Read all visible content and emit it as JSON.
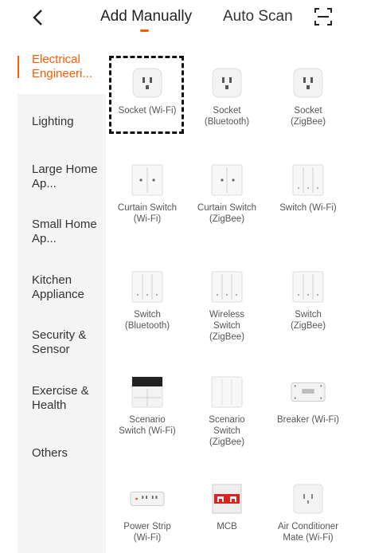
{
  "header": {
    "tab_manual": "Add Manually",
    "tab_auto": "Auto Scan",
    "active_tab": "Add Manually",
    "accent_color": "#ff5a00"
  },
  "sidebar": {
    "items": [
      {
        "label": "Electrical Engineeri...",
        "active": true
      },
      {
        "label": "Lighting"
      },
      {
        "label": "Large Home Ap..."
      },
      {
        "label": "Small Home Ap..."
      },
      {
        "label": "Kitchen Appliance"
      },
      {
        "label": "Security & Sensor"
      },
      {
        "label": "Exercise & Health"
      },
      {
        "label": "Others"
      }
    ]
  },
  "devices": [
    {
      "label": "Socket (Wi-Fi)",
      "icon": "socket-icon",
      "selected": true
    },
    {
      "label": "Socket\n(Bluetooth)",
      "icon": "socket-icon"
    },
    {
      "label": "Socket\n(ZigBee)",
      "icon": "socket-icon"
    },
    {
      "label": "Curtain Switch\n(Wi-Fi)",
      "icon": "curtain-switch-icon"
    },
    {
      "label": "Curtain Switch\n(ZigBee)",
      "icon": "curtain-switch-icon"
    },
    {
      "label": "Switch (Wi-Fi)",
      "icon": "wall-switch-icon"
    },
    {
      "label": "Switch\n(Bluetooth)",
      "icon": "wall-switch-icon"
    },
    {
      "label": "Wireless\nSwitch\n(ZigBee)",
      "icon": "wall-switch-icon"
    },
    {
      "label": "Switch\n(ZigBee)",
      "icon": "wall-switch-icon"
    },
    {
      "label": "Scenario\nSwitch (Wi-Fi)",
      "icon": "scenario-switch-icon"
    },
    {
      "label": "Scenario\nSwitch\n(ZigBee)",
      "icon": "scenario-panel-icon"
    },
    {
      "label": "Breaker (Wi-Fi)",
      "icon": "breaker-icon"
    },
    {
      "label": "Power Strip\n(Wi-Fi)",
      "icon": "power-strip-icon"
    },
    {
      "label": "MCB",
      "icon": "mcb-icon"
    },
    {
      "label": "Air Conditioner\nMate (Wi-Fi)",
      "icon": "ac-mate-icon"
    }
  ]
}
